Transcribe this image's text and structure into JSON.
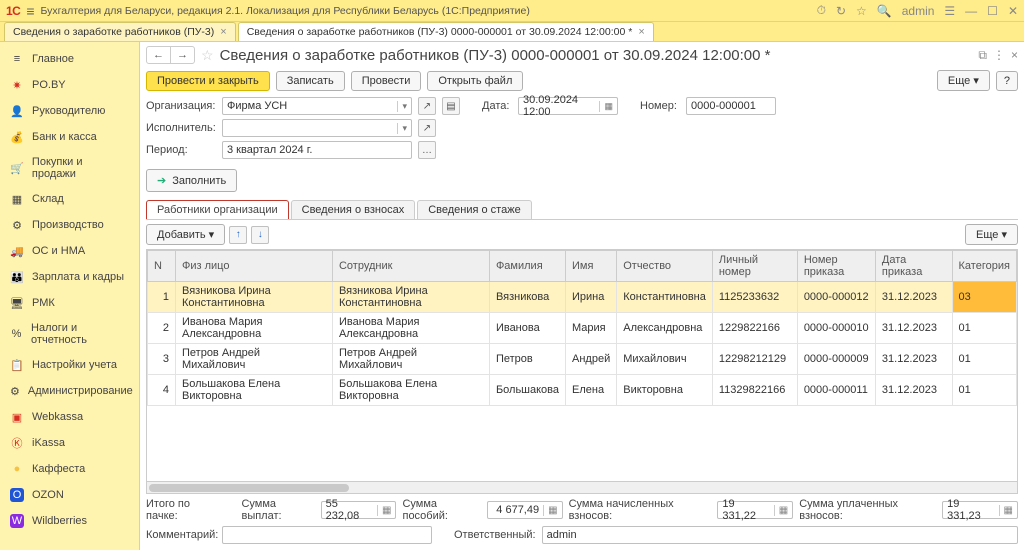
{
  "titlebar": {
    "app_logo": "1С",
    "app_title": "Бухгалтерия для Беларуси, редакция 2.1. Локализация для Республики Беларусь  (1С:Предприятие)",
    "user": "admin"
  },
  "doc_tabs": [
    {
      "label": "Сведения о заработке работников (ПУ-3)",
      "active": false
    },
    {
      "label": "Сведения о заработке работников (ПУ-3) 0000-000001 от 30.09.2024 12:00:00 *",
      "active": true
    }
  ],
  "sidebar": {
    "items": [
      {
        "label": "Главное",
        "icon": "≡"
      },
      {
        "label": "PO.BY",
        "icon": "✷",
        "color": "#d62d20"
      },
      {
        "label": "Руководителю",
        "icon": "👤"
      },
      {
        "label": "Банк и касса",
        "icon": "💰"
      },
      {
        "label": "Покупки и продажи",
        "icon": "🛒"
      },
      {
        "label": "Склад",
        "icon": "▦"
      },
      {
        "label": "Производство",
        "icon": "⚙"
      },
      {
        "label": "ОС и НМА",
        "icon": "🚚"
      },
      {
        "label": "Зарплата и кадры",
        "icon": "👪"
      },
      {
        "label": "РМК",
        "icon": "🖥"
      },
      {
        "label": "Налоги и отчетность",
        "icon": "%"
      },
      {
        "label": "Настройки учета",
        "icon": "📋"
      },
      {
        "label": "Администрирование",
        "icon": "⚙"
      },
      {
        "label": "Webkassa",
        "icon": "W",
        "color": "#d62d20"
      },
      {
        "label": "iKassa",
        "icon": "K",
        "color": "#d62d20"
      },
      {
        "label": "Каффеста",
        "icon": "●",
        "color": "#f5c242"
      },
      {
        "label": "OZON",
        "icon": "O",
        "color": "#2056d6"
      },
      {
        "label": "Wildberries",
        "icon": "W",
        "color": "#8a2be2"
      }
    ]
  },
  "document": {
    "title": "Сведения о заработке работников (ПУ-3) 0000-000001 от 30.09.2024 12:00:00 *",
    "toolbar": {
      "post_close": "Провести и закрыть",
      "save": "Записать",
      "post": "Провести",
      "open_file": "Открыть файл",
      "more": "Еще",
      "help": "?"
    },
    "fields": {
      "org_label": "Организация:",
      "org_value": "Фирма УСН",
      "date_label": "Дата:",
      "date_value": "30.09.2024 12:00",
      "number_label": "Номер:",
      "number_value": "0000-000001",
      "exec_label": "Исполнитель:",
      "exec_value": "",
      "period_label": "Период:",
      "period_value": "3 квартал 2024 г."
    },
    "fill_btn": "Заполнить",
    "inner_tabs": [
      {
        "label": "Работники организации",
        "active": true
      },
      {
        "label": "Сведения о взносах",
        "active": false
      },
      {
        "label": "Сведения о стаже",
        "active": false
      }
    ],
    "tbl_toolbar": {
      "add": "Добавить",
      "more": "Еще"
    },
    "columns": [
      "N",
      "Физ лицо",
      "Сотрудник",
      "Фамилия",
      "Имя",
      "Отчество",
      "Личный номер",
      "Номер приказа",
      "Дата приказа",
      "Категория"
    ],
    "rows": [
      {
        "n": "1",
        "fl": "Вязникова Ирина Константиновна",
        "emp": "Вязникова Ирина Константиновна",
        "ln": "Вязникова",
        "fn": "Ирина",
        "mn": "Константиновна",
        "pid": "1125233632",
        "ord": "0000-000012",
        "odate": "31.12.2023",
        "cat": "03",
        "selected": true
      },
      {
        "n": "2",
        "fl": "Иванова Мария Александровна",
        "emp": "Иванова Мария Александровна",
        "ln": "Иванова",
        "fn": "Мария",
        "mn": "Александровна",
        "pid": "1229822166",
        "ord": "0000-000010",
        "odate": "31.12.2023",
        "cat": "01"
      },
      {
        "n": "3",
        "fl": "Петров Андрей Михайлович",
        "emp": "Петров Андрей Михайлович",
        "ln": "Петров",
        "fn": "Андрей",
        "mn": "Михайлович",
        "pid": "12298212129",
        "ord": "0000-000009",
        "odate": "31.12.2023",
        "cat": "01"
      },
      {
        "n": "4",
        "fl": "Большакова Елена Викторовна",
        "emp": "Большакова Елена Викторовна",
        "ln": "Большакова",
        "fn": "Елена",
        "mn": "Викторовна",
        "pid": "11329822166",
        "ord": "0000-000011",
        "odate": "31.12.2023",
        "cat": "01"
      }
    ],
    "footer": {
      "total_label": "Итого по пачке:",
      "sum_pay_label": "Сумма выплат:",
      "sum_pay": "55 232,08",
      "sum_ben_label": "Сумма пособий:",
      "sum_ben": "4 677,49",
      "sum_contr_label": "Сумма начисленных взносов:",
      "sum_contr": "19 331,22",
      "sum_paid_label": "Сумма уплаченных взносов:",
      "sum_paid": "19 331,23",
      "comment_label": "Комментарий:",
      "resp_label": "Ответственный:",
      "resp_value": "admin"
    }
  }
}
